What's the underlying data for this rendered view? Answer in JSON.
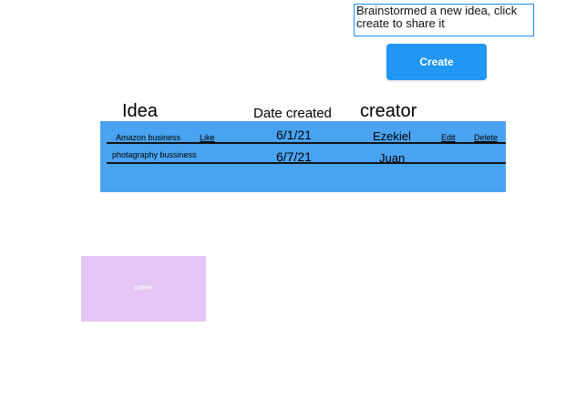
{
  "prompt": {
    "text": "Brainstormed a new idea, click create to share it"
  },
  "create_button": {
    "label": "Create"
  },
  "table": {
    "headers": {
      "idea": "Idea",
      "date": "Date created",
      "creator": "creator"
    },
    "rows": [
      {
        "idea": "Amazon business",
        "like": "Like",
        "date": "6/1/21",
        "creator": "Ezekiel",
        "edit": "Edit",
        "delete": "Delete"
      },
      {
        "idea": "photagraphy bussiness",
        "date": "6/7/21",
        "creator": "Juan"
      }
    ]
  },
  "giphy": {
    "label": "GIPHY"
  },
  "colors": {
    "accent": "#2196f3",
    "table_bg": "#4aa3f0",
    "giphy_bg": "#e6c6f5",
    "prompt_border": "#1e90ff"
  }
}
